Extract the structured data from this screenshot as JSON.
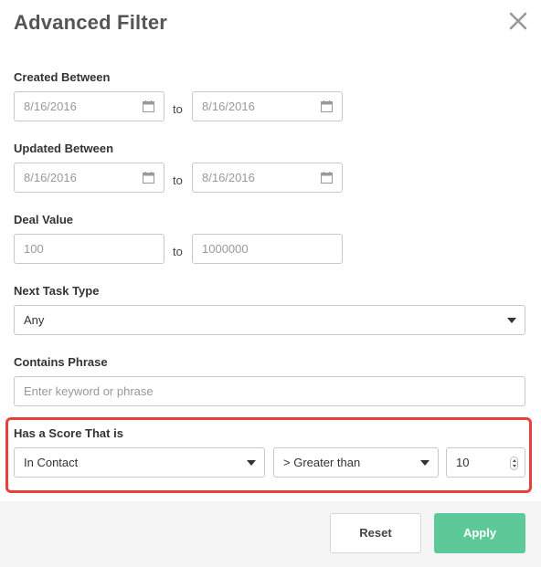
{
  "dialog": {
    "title": "Advanced Filter"
  },
  "created": {
    "label": "Created Between",
    "from": "8/16/2016",
    "to_word": "to",
    "to": "8/16/2016"
  },
  "updated": {
    "label": "Updated Between",
    "from": "8/16/2016",
    "to_word": "to",
    "to": "8/16/2016"
  },
  "deal_value": {
    "label": "Deal Value",
    "from_placeholder": "100",
    "to_word": "to",
    "to_placeholder": "1000000"
  },
  "next_task": {
    "label": "Next Task Type",
    "selected": "Any"
  },
  "phrase": {
    "label": "Contains Phrase",
    "placeholder": "Enter keyword or phrase"
  },
  "score": {
    "label": "Has a Score That is",
    "scope": "In Contact",
    "operator": "> Greater than",
    "value": "10"
  },
  "footer": {
    "reset_label": "Reset",
    "apply_label": "Apply"
  },
  "colors": {
    "highlight": "#e8413c",
    "apply": "#5dc999",
    "footer_bg": "#f5f5f5"
  },
  "icons": [
    "close-icon",
    "calendar-icon",
    "chevron-down-icon",
    "number-spinner-icon"
  ]
}
